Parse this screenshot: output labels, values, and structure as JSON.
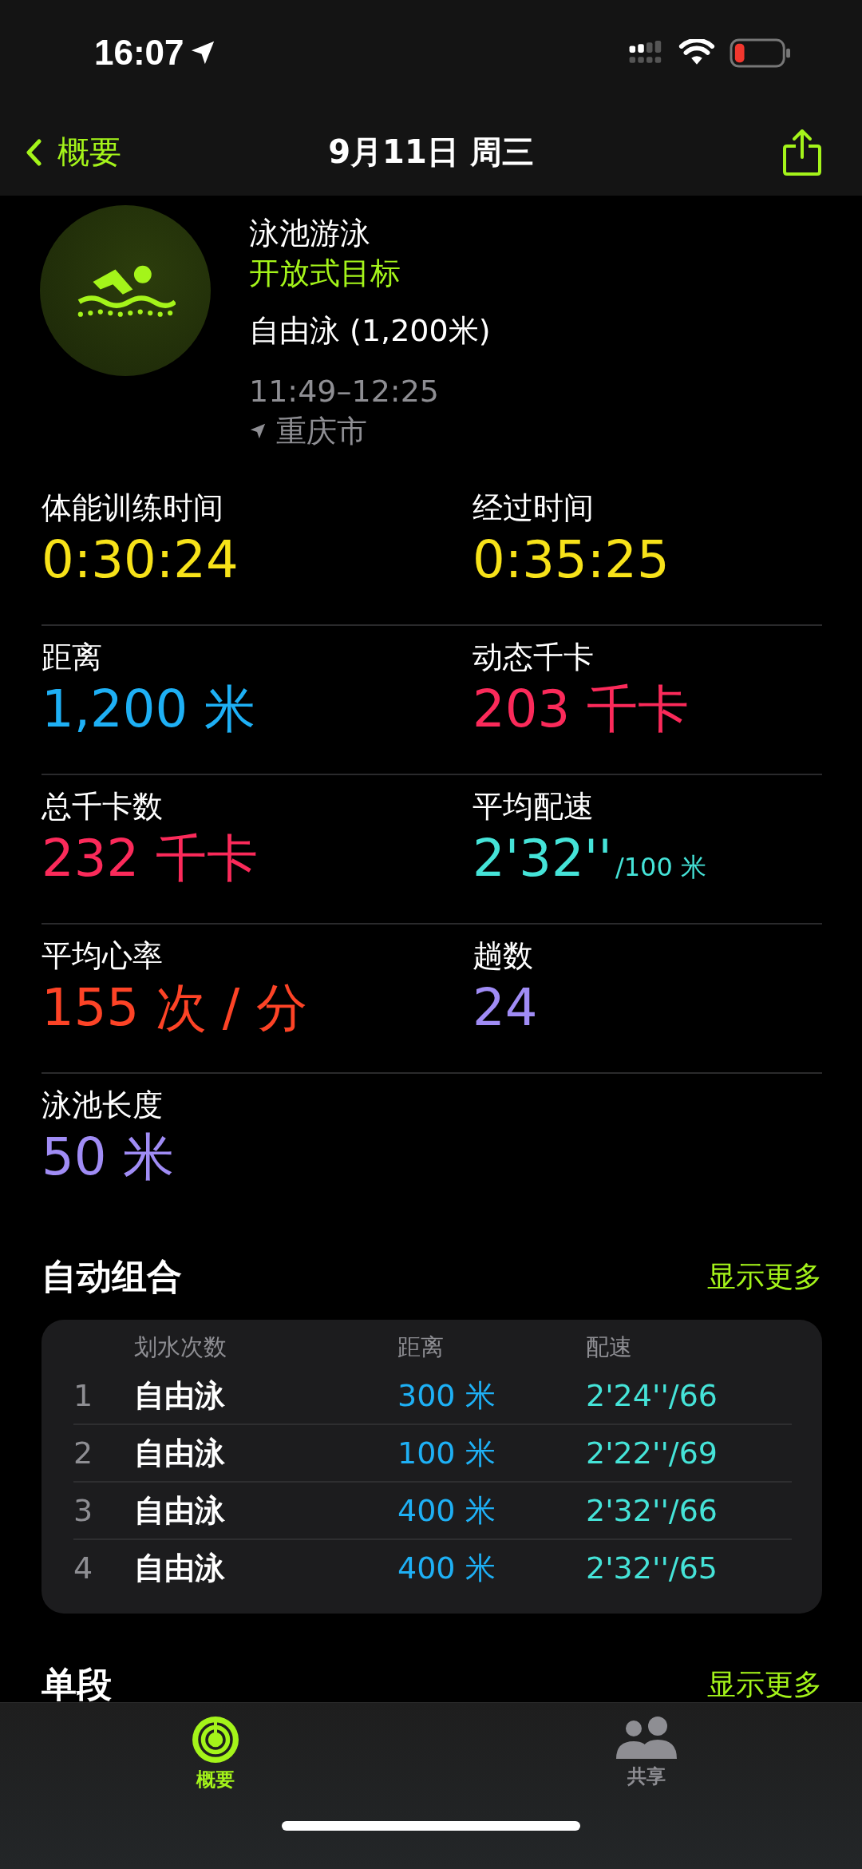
{
  "status_bar": {
    "time": "16:07"
  },
  "nav": {
    "back": "概要",
    "title": "9月11日 周三"
  },
  "workout": {
    "title": "泳池游泳",
    "goal": "开放式目标",
    "stroke": "自由泳 (1,200米)",
    "time_range": "11:49–12:25",
    "location": "重庆市"
  },
  "stats": [
    {
      "label": "体能训练时间",
      "value": "0:30:24",
      "color": "#f7e219"
    },
    {
      "label": "经过时间",
      "value": "0:35:25",
      "color": "#f7e219"
    },
    {
      "label": "距离",
      "value": "1,200 米",
      "color": "#1eb0f5"
    },
    {
      "label": "动态千卡",
      "value": "203 千卡",
      "color": "#fb2a5a"
    },
    {
      "label": "总千卡数",
      "value": "232 千卡",
      "color": "#fb2a5a"
    },
    {
      "label": "平均配速",
      "value": "2'32''",
      "suffix": "/100 米",
      "color": "#45e3d8"
    },
    {
      "label": "平均心率",
      "value": "155 次 / 分",
      "color": "#fd4326"
    },
    {
      "label": "趟数",
      "value": "24",
      "color": "#a08cf5"
    },
    {
      "label": "泳池长度",
      "value": "50 米",
      "color": "#a08cf5"
    }
  ],
  "auto_sets": {
    "title": "自动组合",
    "more": "显示更多",
    "columns": [
      "划水次数",
      "距离",
      "配速"
    ],
    "rows": [
      {
        "index": "1",
        "stroke": "自由泳",
        "distance": "300 米",
        "pace": "2'24''/66"
      },
      {
        "index": "2",
        "stroke": "自由泳",
        "distance": "100 米",
        "pace": "2'22''/69"
      },
      {
        "index": "3",
        "stroke": "自由泳",
        "distance": "400 米",
        "pace": "2'32''/66"
      },
      {
        "index": "4",
        "stroke": "自由泳",
        "distance": "400 米",
        "pace": "2'32''/65"
      }
    ]
  },
  "segments": {
    "title": "单段",
    "more": "显示更多"
  },
  "tab_bar": [
    {
      "kind": "summary",
      "label": "概要",
      "selected": true
    },
    {
      "kind": "sharing",
      "label": "共享",
      "selected": false
    }
  ]
}
